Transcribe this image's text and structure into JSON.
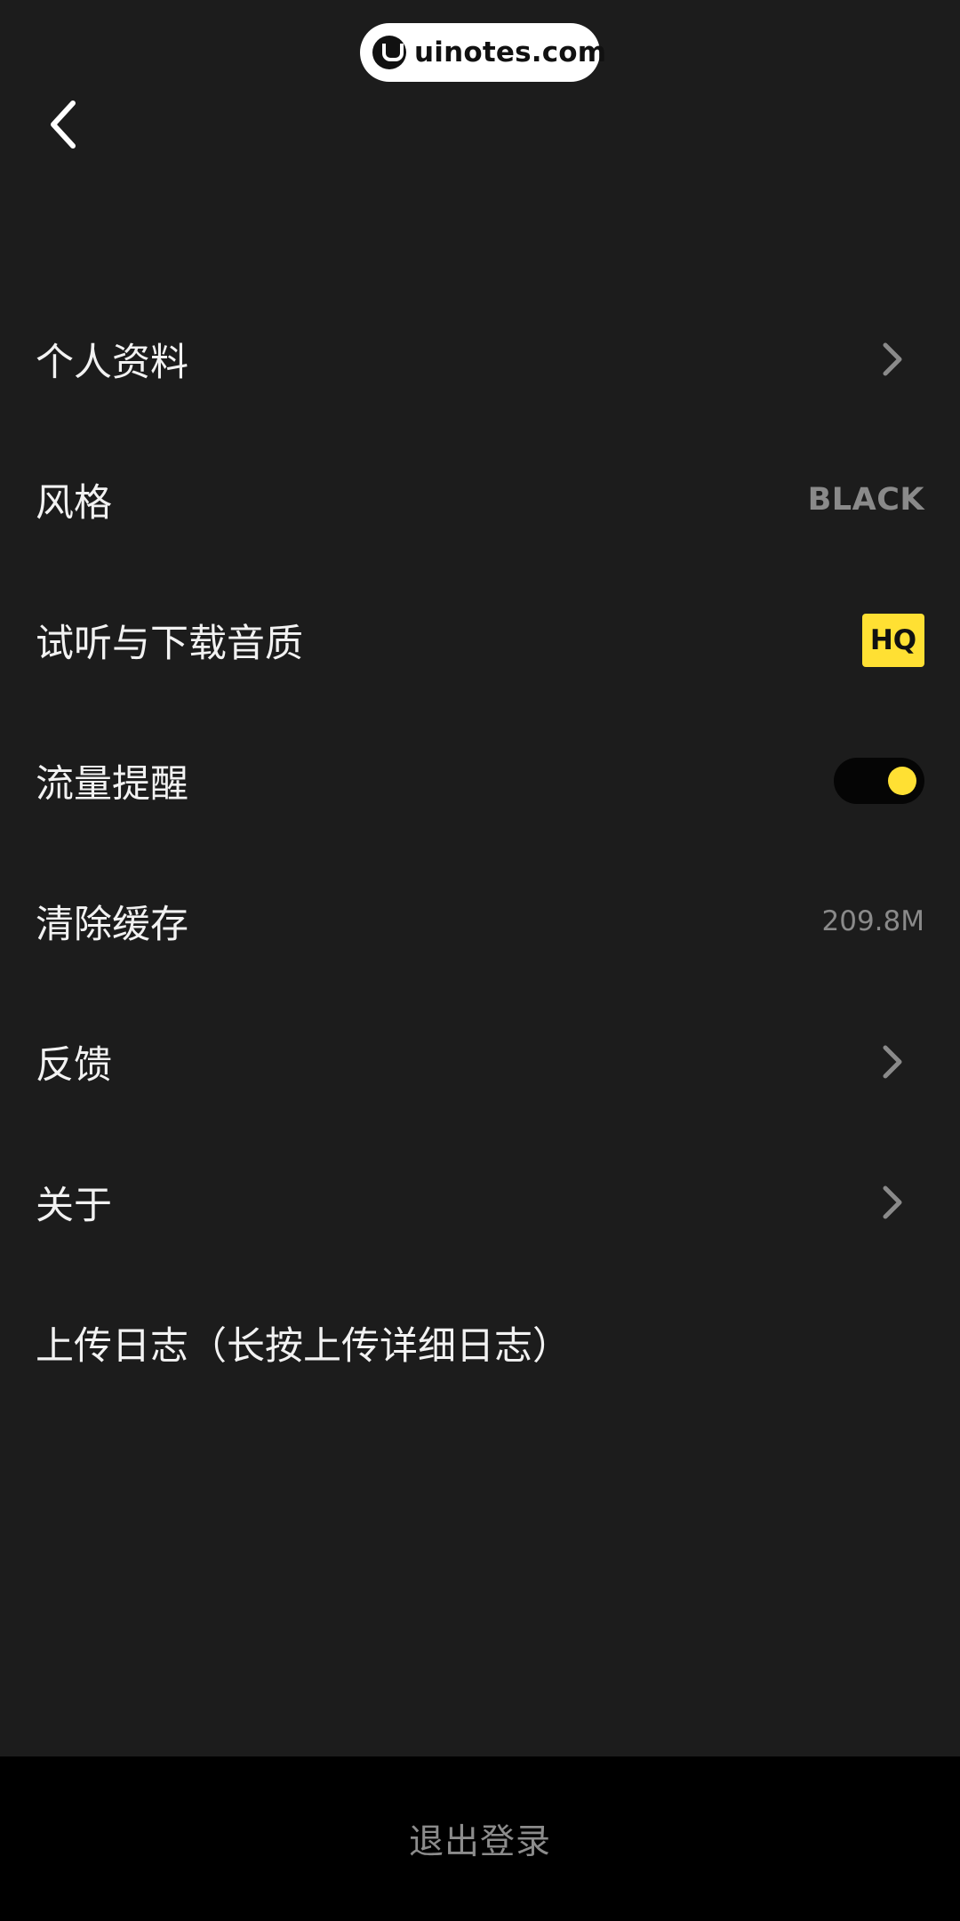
{
  "watermark": {
    "text": "uinotes.com"
  },
  "header": {
    "back_icon": "chevron-left-icon"
  },
  "settings": {
    "items": [
      {
        "label": "个人资料",
        "accessory": "chevron",
        "icon": "chevron-right-icon"
      },
      {
        "label": "风格",
        "accessory": "value",
        "value": "BLACK"
      },
      {
        "label": "试听与下载音质",
        "accessory": "badge",
        "value": "HQ"
      },
      {
        "label": "流量提醒",
        "accessory": "toggle",
        "enabled": true
      },
      {
        "label": "清除缓存",
        "accessory": "value",
        "value": "209.8M"
      },
      {
        "label": "反馈",
        "accessory": "chevron",
        "icon": "chevron-right-icon"
      },
      {
        "label": "关于",
        "accessory": "chevron",
        "icon": "chevron-right-icon"
      },
      {
        "label": "上传日志（长按上传详细日志）",
        "accessory": "none"
      }
    ]
  },
  "footer": {
    "logout_label": "退出登录"
  },
  "colors": {
    "background": "#1c1c1c",
    "footer_background": "#000000",
    "accent": "#ffe033",
    "secondary_text": "#8a8a8a"
  }
}
